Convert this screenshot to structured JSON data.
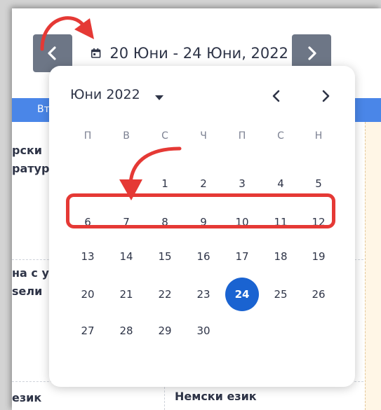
{
  "toolbar": {
    "prev_icon": "chevron-left-icon",
    "next_icon": "chevron-right-icon",
    "calendar_icon": "calendar-icon",
    "date_range": "20 Юни - 24 Юни, 2022"
  },
  "schedule": {
    "header_color": "#4a86e8",
    "left_header": "Вт",
    "cells": [
      {
        "lines": [
          "рски",
          "ратур"
        ]
      },
      {
        "lines": [
          "на с у",
          "ѕели"
        ]
      },
      {
        "lines": [
          "език"
        ]
      },
      {
        "lines": [
          "Немски език"
        ]
      }
    ]
  },
  "calendar": {
    "month_label": "Юни 2022",
    "weekdays": [
      "П",
      "В",
      "С",
      "Ч",
      "П",
      "С",
      "Н"
    ],
    "weeks": [
      [
        "",
        "",
        "1",
        "2",
        "3",
        "4",
        "5"
      ],
      [
        "6",
        "7",
        "8",
        "9",
        "10",
        "11",
        "12"
      ],
      [
        "13",
        "14",
        "15",
        "16",
        "17",
        "18",
        "19"
      ],
      [
        "20",
        "21",
        "22",
        "23",
        "24",
        "25",
        "26"
      ],
      [
        "27",
        "28",
        "29",
        "30",
        "",
        "",
        ""
      ]
    ],
    "selected_day": "24",
    "selected_color": "#1a63d1"
  },
  "annotations": {
    "color": "#e53935",
    "highlighted_week": [
      "6",
      "7",
      "8",
      "9",
      "10",
      "11",
      "12"
    ]
  }
}
